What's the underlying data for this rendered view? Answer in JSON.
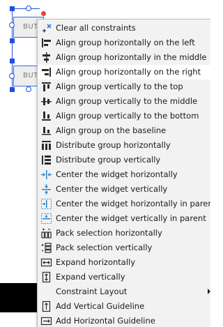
{
  "canvas": {
    "widgets": [
      {
        "label": "BUT"
      },
      {
        "label": "BUT"
      }
    ]
  },
  "menu": {
    "items": [
      {
        "label": "Clear all constraints",
        "icon": "clear-constraints-icon"
      },
      {
        "label": "Align group horizontally on the left",
        "icon": "align-left-icon"
      },
      {
        "label": "Align group horizontally in the middle",
        "icon": "align-center-icon"
      },
      {
        "label": "Align group horizontally on the right",
        "icon": "align-right-icon"
      },
      {
        "label": "Align group vertically to the top",
        "icon": "align-top-icon"
      },
      {
        "label": "Align group vertically to the middle",
        "icon": "align-vertical-middle-icon"
      },
      {
        "label": "Align group vertically to the bottom",
        "icon": "align-bottom-icon"
      },
      {
        "label": "Align group on the baseline",
        "icon": "align-baseline-icon"
      },
      {
        "label": "Distribute group horizontally",
        "icon": "distribute-horizontal-icon"
      },
      {
        "label": "Distribute group vertically",
        "icon": "distribute-vertical-icon"
      },
      {
        "label": "Center the widget horizontally",
        "icon": "center-horizontal-icon"
      },
      {
        "label": "Center the widget vertically",
        "icon": "center-vertical-icon"
      },
      {
        "label": "Center the widget horizontally in parent",
        "icon": "center-horizontal-parent-icon"
      },
      {
        "label": "Center the widget vertically in parent",
        "icon": "center-vertical-parent-icon"
      },
      {
        "label": "Pack selection horizontally",
        "icon": "pack-horizontal-icon"
      },
      {
        "label": "Pack selection vertically",
        "icon": "pack-vertical-icon"
      },
      {
        "label": "Expand horizontally",
        "icon": "expand-horizontal-icon"
      },
      {
        "label": "Expand vertically",
        "icon": "expand-vertical-icon"
      },
      {
        "label": "Constraint Layout",
        "icon": "",
        "submenu": true
      },
      {
        "label": "Add Vertical Guideline",
        "icon": "vertical-guideline-icon"
      },
      {
        "label": "Add Horizontal Guideline",
        "icon": "horizontal-guideline-icon"
      }
    ],
    "hovered_index": 3
  },
  "colors": {
    "accent": "#1f4fe0",
    "icon_dark": "#2b2b2b",
    "icon_blue": "#2a7fd4",
    "warning": "#e8413b",
    "menu_bg": "#f2f2f2",
    "hover_bg": "#ffffff"
  }
}
